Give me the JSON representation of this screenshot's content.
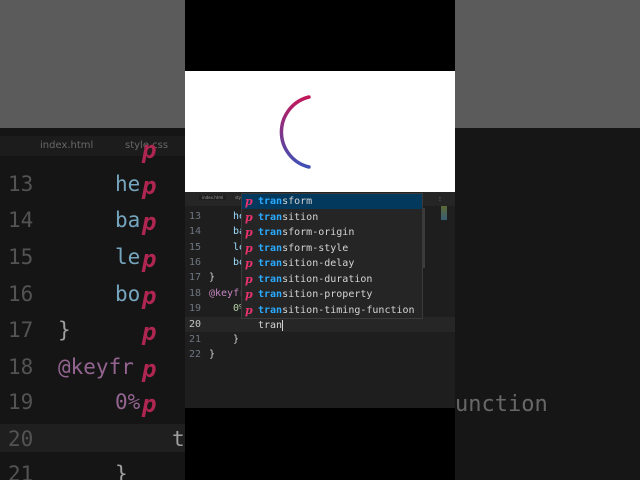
{
  "background": {
    "tabs": [
      "index.html",
      "style.css"
    ],
    "line_numbers": [
      "13",
      "14",
      "15",
      "16",
      "17",
      "18",
      "19",
      "20",
      "21"
    ],
    "code_fragments": [
      "he",
      "ba",
      "le",
      "bo",
      "}",
      "@keyfr",
      "0%",
      "t",
      "}"
    ],
    "right_text": "unction"
  },
  "editor": {
    "tabs": [
      "index.html",
      "style.css"
    ],
    "lines": [
      {
        "num": "13",
        "text": "he"
      },
      {
        "num": "14",
        "text": "ba"
      },
      {
        "num": "15",
        "text": "le"
      },
      {
        "num": "16",
        "text": "bo"
      },
      {
        "num": "17",
        "text": "}"
      },
      {
        "num": "18",
        "text": "@keyfr"
      },
      {
        "num": "19",
        "text": "0%"
      },
      {
        "num": "20",
        "text": ""
      },
      {
        "num": "21",
        "text": "}"
      },
      {
        "num": "22",
        "text": "}"
      }
    ],
    "typed_text": "tran",
    "minimap_label": "⁝"
  },
  "autocomplete": {
    "icon": "p",
    "match": "tran",
    "items": [
      {
        "match": "tran",
        "rest": "sform"
      },
      {
        "match": "tran",
        "rest": "sition"
      },
      {
        "match": "tran",
        "rest": "sform-origin"
      },
      {
        "match": "tran",
        "rest": "sform-style"
      },
      {
        "match": "tran",
        "rest": "sition-delay"
      },
      {
        "match": "tran",
        "rest": "sition-duration"
      },
      {
        "match": "tran",
        "rest": "sition-property"
      },
      {
        "match": "tran",
        "rest": "sition-timing-function"
      }
    ],
    "selected_index": 0
  },
  "colors": {
    "accent_pink": "#e8336c",
    "match_blue": "#2aaaff",
    "selection": "#04395e",
    "spinner_start": "#c2185b",
    "spinner_end": "#3f51b5"
  }
}
